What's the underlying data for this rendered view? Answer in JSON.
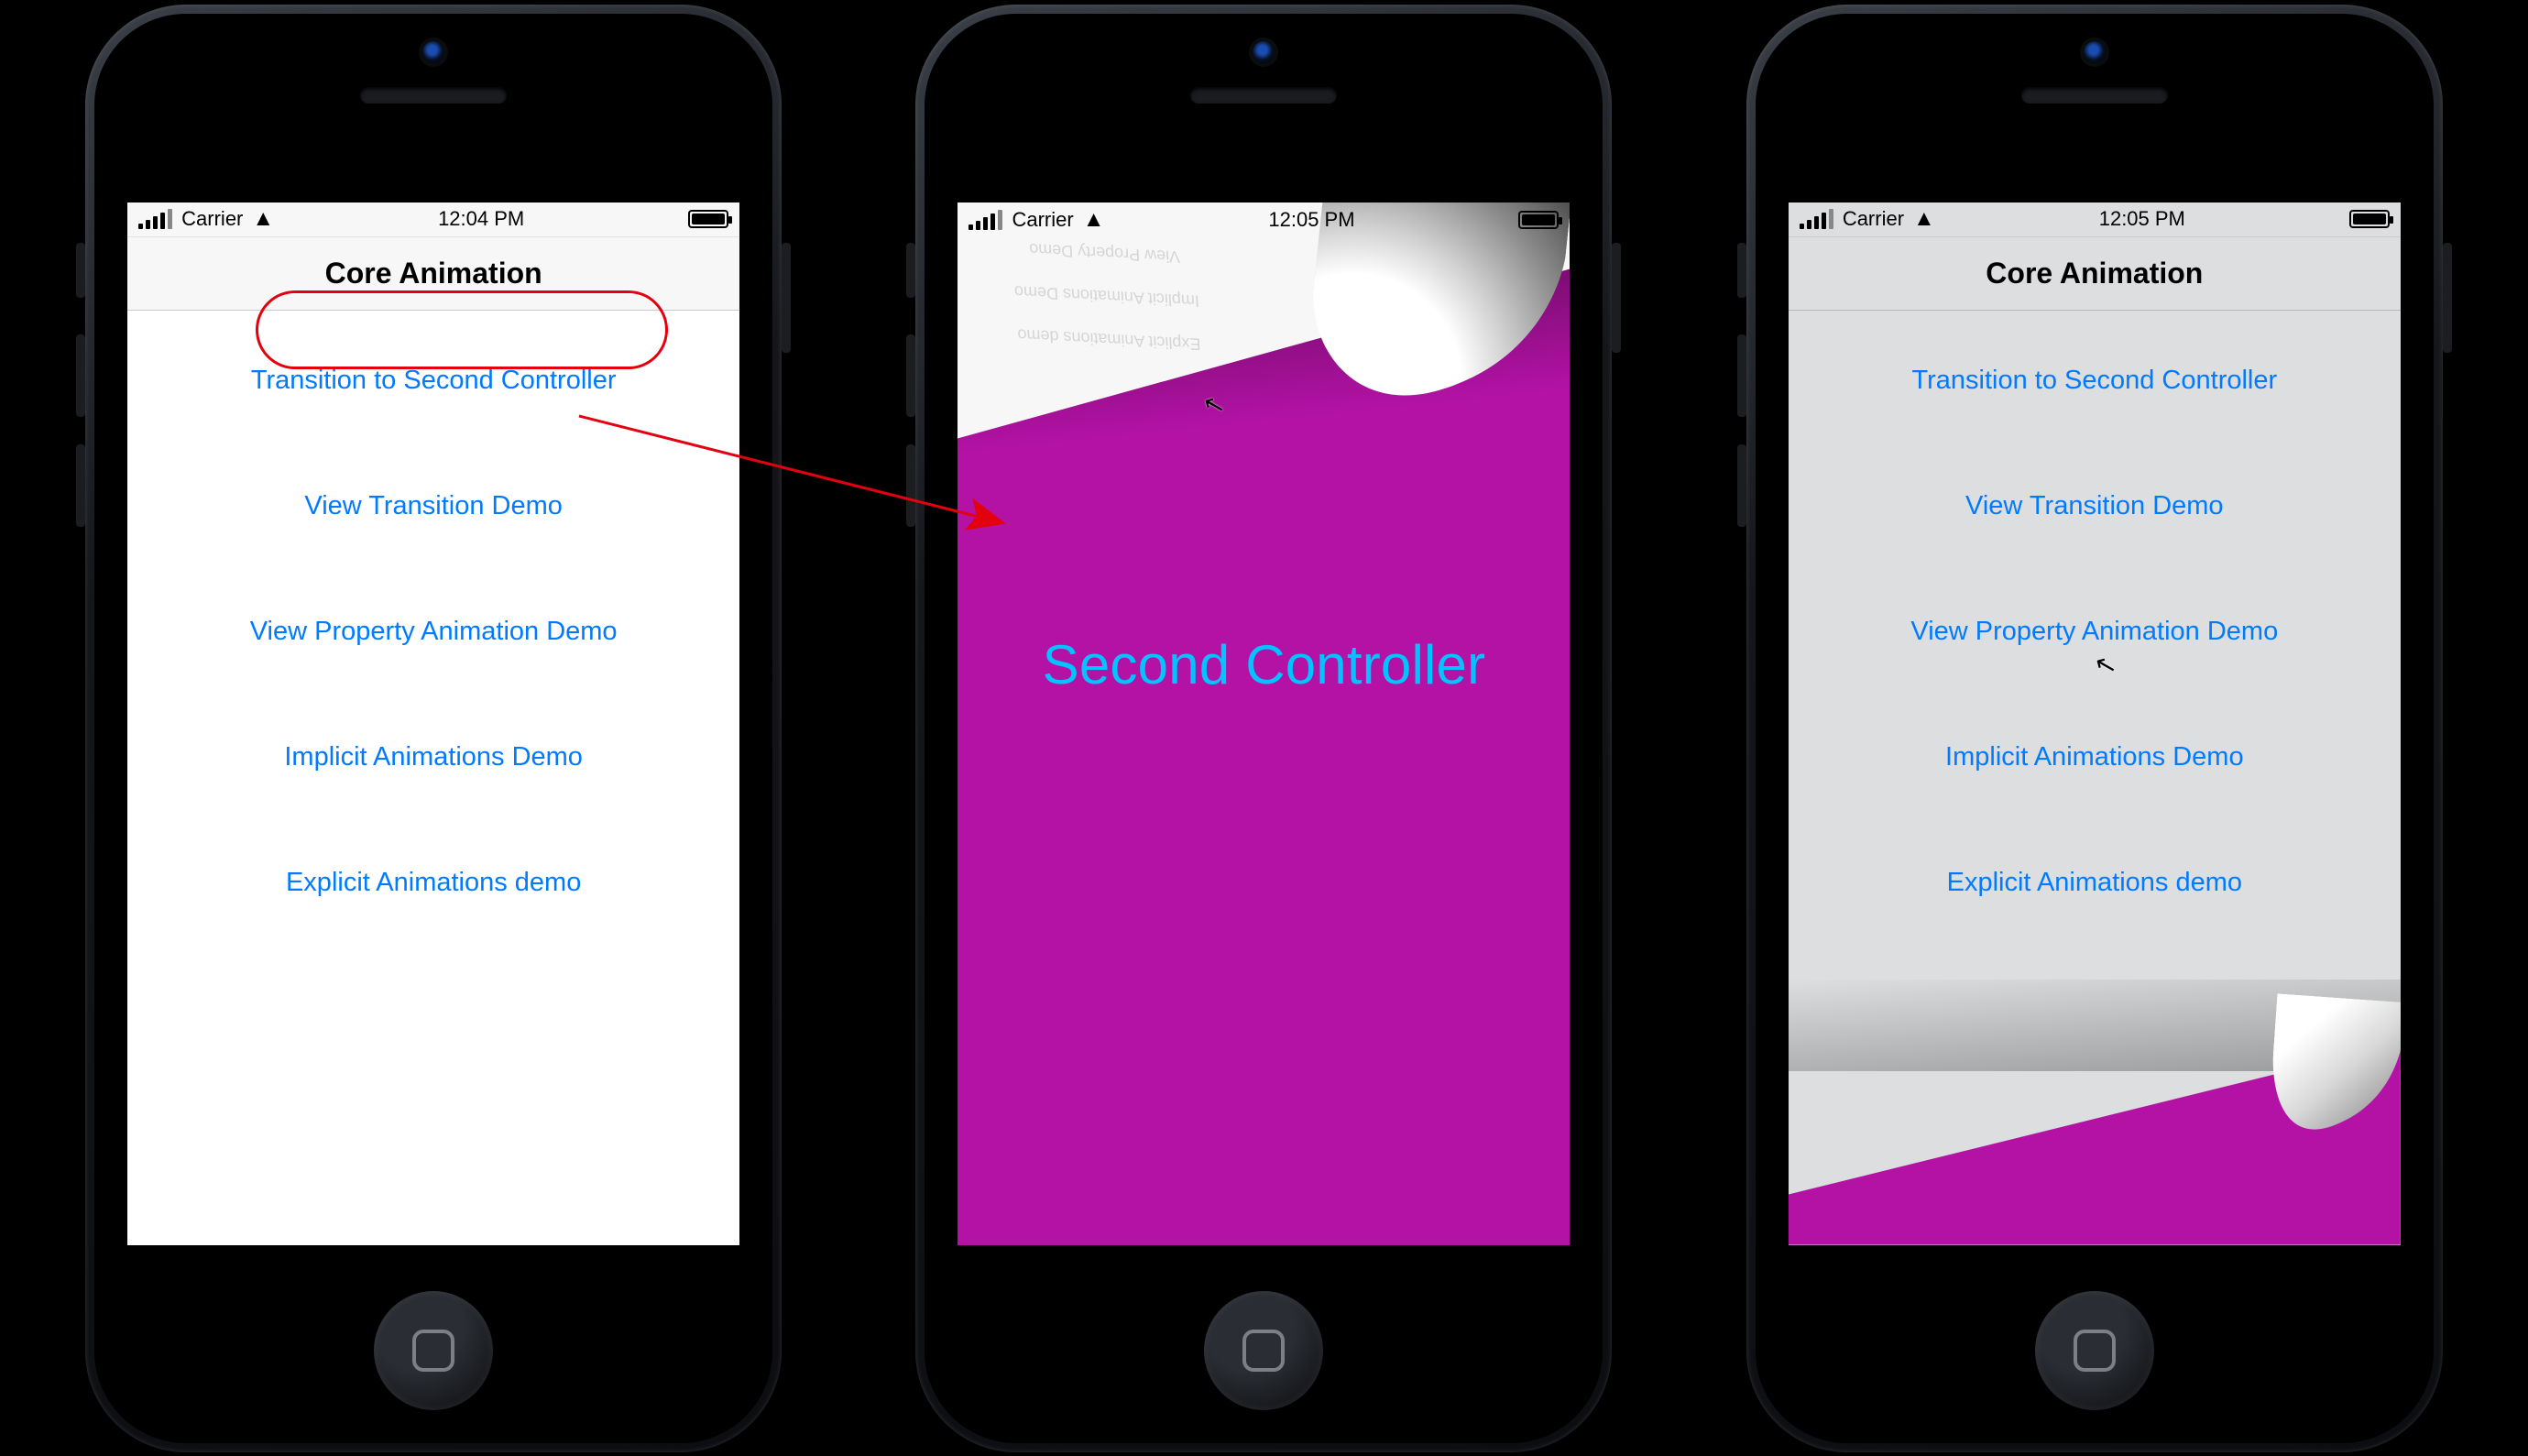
{
  "colors": {
    "link": "#007aff",
    "accent": "#b312a5",
    "callout": "#e3000f",
    "cyan": "#00c3ff"
  },
  "phone1": {
    "status": {
      "carrier": "Carrier",
      "time": "12:04 PM"
    },
    "nav_title": "Core Animation",
    "menu": [
      "Transition to Second Controller",
      "View Transition Demo",
      "View Property Animation Demo",
      "Implicit Animations Demo",
      "Explicit Animations demo"
    ],
    "highlight_index": 0
  },
  "phone2": {
    "status": {
      "carrier": "Carrier",
      "time": "12:05 PM"
    },
    "title": "Second Controller",
    "ghost_lines": [
      "Explicit Animations demo",
      "Implicit Animations Demo",
      "View Property Demo"
    ]
  },
  "phone3": {
    "status": {
      "carrier": "Carrier",
      "time": "12:05 PM"
    },
    "nav_title": "Core Animation",
    "menu": [
      "Transition to Second Controller",
      "View Transition Demo",
      "View Property Animation Demo",
      "Implicit Animations Demo",
      "Explicit Animations demo"
    ]
  }
}
